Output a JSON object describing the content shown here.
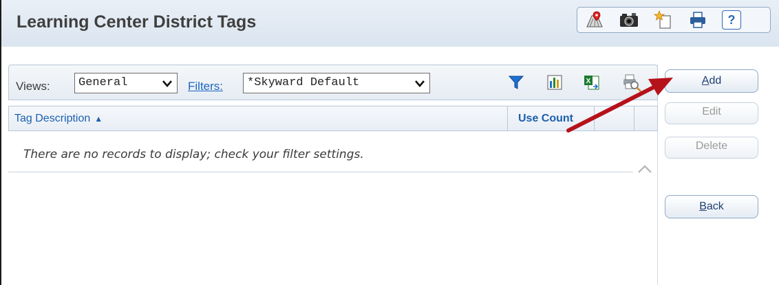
{
  "page": {
    "title": "Learning Center District Tags"
  },
  "toolbar": {
    "icons": [
      "map-pin-icon",
      "camera-icon",
      "new-window-icon",
      "printer-icon",
      "help-icon"
    ],
    "help_label": "?"
  },
  "views_bar": {
    "views_label": "Views:",
    "views_value": "General",
    "filters_label": "Filters:",
    "filters_value": "*Skyward Default",
    "icons": [
      "filter-icon",
      "chart-icon",
      "excel-export-icon",
      "print-preview-icon"
    ]
  },
  "grid": {
    "columns": [
      {
        "label": "Tag Description",
        "sort": "▲"
      },
      {
        "label": "Use Count"
      }
    ],
    "empty_message": "There are no records to display; check your filter settings."
  },
  "actions": {
    "add_key": "A",
    "add_rest": "dd",
    "edit": "Edit",
    "delete": "Delete",
    "back_key": "B",
    "back_rest": "ack"
  },
  "colors": {
    "accent": "#1b66c1",
    "arrow": "#b5121b"
  }
}
